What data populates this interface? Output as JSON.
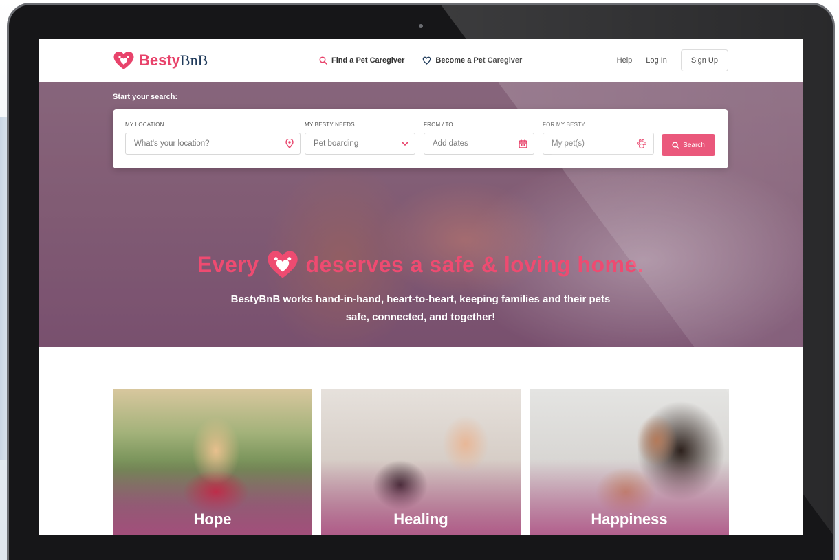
{
  "brand": {
    "name_primary": "Besty",
    "name_secondary": "BnB",
    "accent_color": "#e8436b",
    "secondary_color": "#1f3a5a"
  },
  "nav": {
    "find_caregiver": "Find a Pet Caregiver",
    "become_caregiver": "Become a Pet Caregiver",
    "help": "Help",
    "login": "Log In",
    "signup": "Sign Up"
  },
  "search": {
    "heading": "Start your search:",
    "location_label": "MY LOCATION",
    "location_placeholder": "What's your location?",
    "needs_label": "MY BESTY NEEDS",
    "needs_value": "Pet boarding",
    "dates_label": "FROM / TO",
    "dates_placeholder": "Add dates",
    "pets_label": "FOR MY BESTY",
    "pets_placeholder": "My pet(s)",
    "button": "Search"
  },
  "hero": {
    "headline_before": "Every",
    "headline_after": "deserves a safe & loving home.",
    "subline_1": "BestyBnB works hand-in-hand, heart-to-heart, keeping families and their pets",
    "subline_2": "safe, connected, and together!"
  },
  "cards": [
    {
      "label": "Hope"
    },
    {
      "label": "Healing"
    },
    {
      "label": "Happiness"
    }
  ]
}
